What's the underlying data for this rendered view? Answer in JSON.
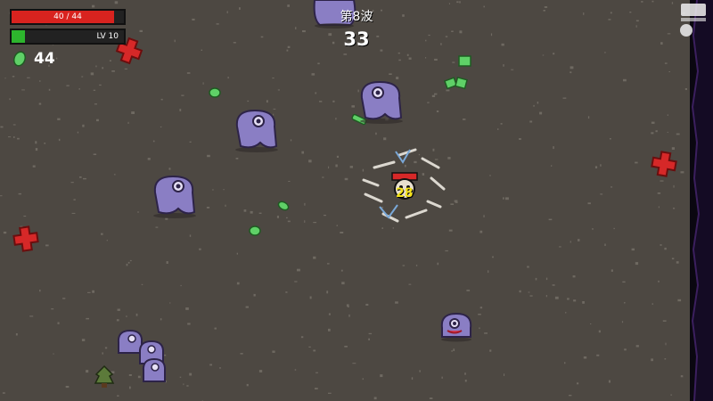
{
  "hud": {
    "hp": {
      "current": 40,
      "max": 44,
      "text": "40 / 44"
    },
    "xp": {
      "fraction": 0.12,
      "level_text": "LV 10"
    },
    "materials": {
      "count": "44",
      "icon": "material-icon"
    }
  },
  "wave": {
    "label": "第8波",
    "timer": "33"
  },
  "combat": {
    "damage_popup": "28"
  },
  "colors": {
    "floor": "#4d4842",
    "hp_fill": "#d8231f",
    "xp_fill": "#2db52d",
    "enemy": "#8a7ec4",
    "material": "#5fd067",
    "damage_text": "#f4e21a",
    "health_cross": "#d62828"
  },
  "icons": [
    "material-icon",
    "health-cross-icon",
    "watermark-logo"
  ]
}
